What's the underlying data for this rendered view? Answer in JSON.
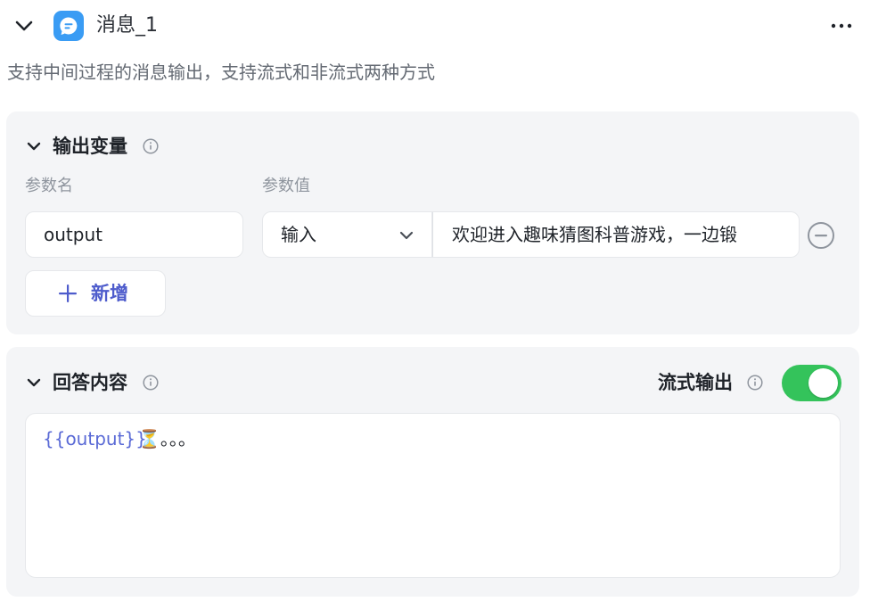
{
  "node": {
    "title": "消息_1",
    "description": "支持中间过程的消息输出，支持流式和非流式两种方式",
    "icon": "chat-bubble-icon",
    "accent": "#3a9cf4"
  },
  "output_section": {
    "title": "输出变量",
    "col_name_label": "参数名",
    "col_value_label": "参数值",
    "rows": [
      {
        "name": "output",
        "type": "输入",
        "value": "欢迎进入趣味猜图科普游戏，一边锻"
      }
    ],
    "add_label": "新增"
  },
  "answer_section": {
    "title": "回答内容",
    "stream_label": "流式输出",
    "stream_on": true,
    "content_variable": "{{output}}",
    "content_rest": "⏳。。。"
  },
  "colors": {
    "toggle_on": "#34c35b",
    "link": "#4e5ccc",
    "variable": "#5a6ad6"
  }
}
